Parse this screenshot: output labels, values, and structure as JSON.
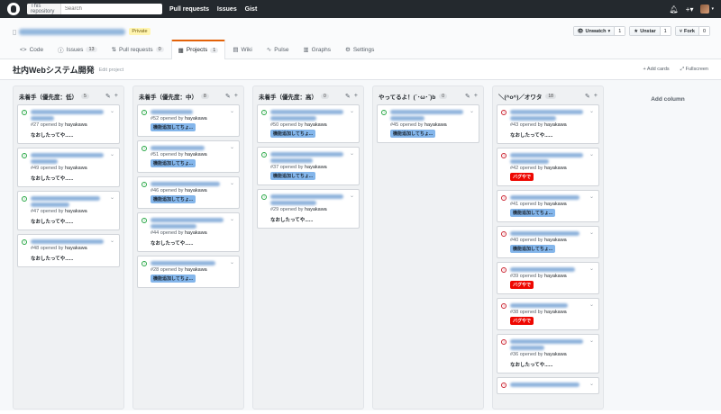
{
  "header": {
    "search_scope": "This repository",
    "search_placeholder": "Search",
    "nav": [
      "Pull requests",
      "Issues",
      "Gist"
    ]
  },
  "repo": {
    "private_label": "Private",
    "watch": {
      "label": "Unwatch",
      "count": "1"
    },
    "star": {
      "label": "Unstar",
      "count": "1"
    },
    "fork": {
      "label": "Fork",
      "count": "0"
    },
    "tabs": [
      {
        "label": "Code",
        "count": ""
      },
      {
        "label": "Issues",
        "count": "13"
      },
      {
        "label": "Pull requests",
        "count": "0"
      },
      {
        "label": "Projects",
        "count": "1"
      },
      {
        "label": "Wiki",
        "count": ""
      },
      {
        "label": "Pulse",
        "count": ""
      },
      {
        "label": "Graphs",
        "count": ""
      },
      {
        "label": "Settings",
        "count": ""
      }
    ]
  },
  "project": {
    "title": "社内Webシステム開発",
    "edit_label": "Edit project",
    "add_cards": "Add cards",
    "fullscreen": "Fullscreen"
  },
  "columns": [
    {
      "name": "未着手（優先度：低）",
      "count": "5",
      "cards": [
        {
          "num": "#27",
          "author": "hayakawa",
          "state": "open",
          "lines": [
            0.95,
            0.3
          ],
          "note": "なおしたってや......",
          "label": "",
          "label_type": ""
        },
        {
          "num": "#49",
          "author": "hayakawa",
          "state": "open",
          "lines": [
            0.95,
            0.35
          ],
          "note": "なおしたってや......",
          "label": "",
          "label_type": ""
        },
        {
          "num": "#47",
          "author": "hayakawa",
          "state": "open",
          "lines": [
            0.9,
            0.5
          ],
          "note": "なおしたってや......",
          "label": "",
          "label_type": ""
        },
        {
          "num": "#48",
          "author": "hayakawa",
          "state": "open",
          "lines": [
            0.95
          ],
          "note": "なおしたってや......",
          "label": "",
          "label_type": ""
        }
      ]
    },
    {
      "name": "未着手（優先度：中）",
      "count": "8",
      "cards": [
        {
          "num": "#52",
          "author": "hayakawa",
          "state": "open",
          "lines": [
            0.55
          ],
          "note": "",
          "label": "機能追加してちょ...",
          "label_type": "feat"
        },
        {
          "num": "#51",
          "author": "hayakawa",
          "state": "open",
          "lines": [
            0.7
          ],
          "note": "",
          "label": "機能追加してちょ...",
          "label_type": "feat"
        },
        {
          "num": "#46",
          "author": "hayakawa",
          "state": "open",
          "lines": [
            0.9
          ],
          "note": "",
          "label": "機能追加してちょ...",
          "label_type": "feat"
        },
        {
          "num": "#44",
          "author": "hayakawa",
          "state": "open",
          "lines": [
            0.95,
            0.6
          ],
          "note": "なおしたってや......",
          "label": "",
          "label_type": ""
        },
        {
          "num": "#28",
          "author": "hayakawa",
          "state": "open",
          "lines": [
            0.85
          ],
          "note": "",
          "label": "機能追加してちょ...",
          "label_type": "feat"
        }
      ]
    },
    {
      "name": "未着手（優先度：高）",
      "count": "0",
      "cards": [
        {
          "num": "#50",
          "author": "hayakawa",
          "state": "open",
          "lines": [
            0.95,
            0.6
          ],
          "note": "",
          "label": "機能追加してちょ...",
          "label_type": "feat"
        },
        {
          "num": "#37",
          "author": "hayakawa",
          "state": "open",
          "lines": [
            0.95,
            0.55
          ],
          "note": "",
          "label": "機能追加してちょ...",
          "label_type": "feat"
        },
        {
          "num": "#29",
          "author": "hayakawa",
          "state": "open",
          "lines": [
            0.95,
            0.6
          ],
          "note": "なおしたってや......",
          "label": "",
          "label_type": ""
        }
      ]
    },
    {
      "name": "やってるよ！(´･ω･`)b",
      "count": "0",
      "cards": [
        {
          "num": "#45",
          "author": "hayakawa",
          "state": "open",
          "lines": [
            0.95,
            0.45
          ],
          "note": "",
          "label": "機能追加してちょ...",
          "label_type": "feat"
        }
      ]
    },
    {
      "name": "＼(^o^)／オワタ",
      "count": "18",
      "cards": [
        {
          "num": "#43",
          "author": "hayakawa",
          "state": "closed",
          "lines": [
            0.95,
            0.6
          ],
          "note": "なおしたってや......",
          "label": "",
          "label_type": ""
        },
        {
          "num": "#42",
          "author": "hayakawa",
          "state": "closed",
          "lines": [
            0.95,
            0.5
          ],
          "note": "",
          "label": "バグやで",
          "label_type": "bug"
        },
        {
          "num": "#41",
          "author": "hayakawa",
          "state": "closed",
          "lines": [
            0.9
          ],
          "note": "",
          "label": "機能追加してちょ...",
          "label_type": "feat"
        },
        {
          "num": "#40",
          "author": "hayakawa",
          "state": "closed",
          "lines": [
            0.9
          ],
          "note": "",
          "label": "機能追加してちょ...",
          "label_type": "feat"
        },
        {
          "num": "#39",
          "author": "hayakawa",
          "state": "closed",
          "lines": [
            0.85
          ],
          "note": "",
          "label": "バグやで",
          "label_type": "bug"
        },
        {
          "num": "#38",
          "author": "hayakawa",
          "state": "closed",
          "lines": [
            0.75
          ],
          "note": "",
          "label": "バグやで",
          "label_type": "bug"
        },
        {
          "num": "#36",
          "author": "hayakawa",
          "state": "closed",
          "lines": [
            0.95,
            0.45
          ],
          "note": "なおしたってや......",
          "label": "",
          "label_type": ""
        },
        {
          "num": "",
          "author": "",
          "state": "closed",
          "lines": [
            0.9
          ],
          "note": "",
          "label": "",
          "label_type": ""
        }
      ]
    }
  ],
  "add_column_label": "Add column",
  "opened_by_text": "opened by"
}
